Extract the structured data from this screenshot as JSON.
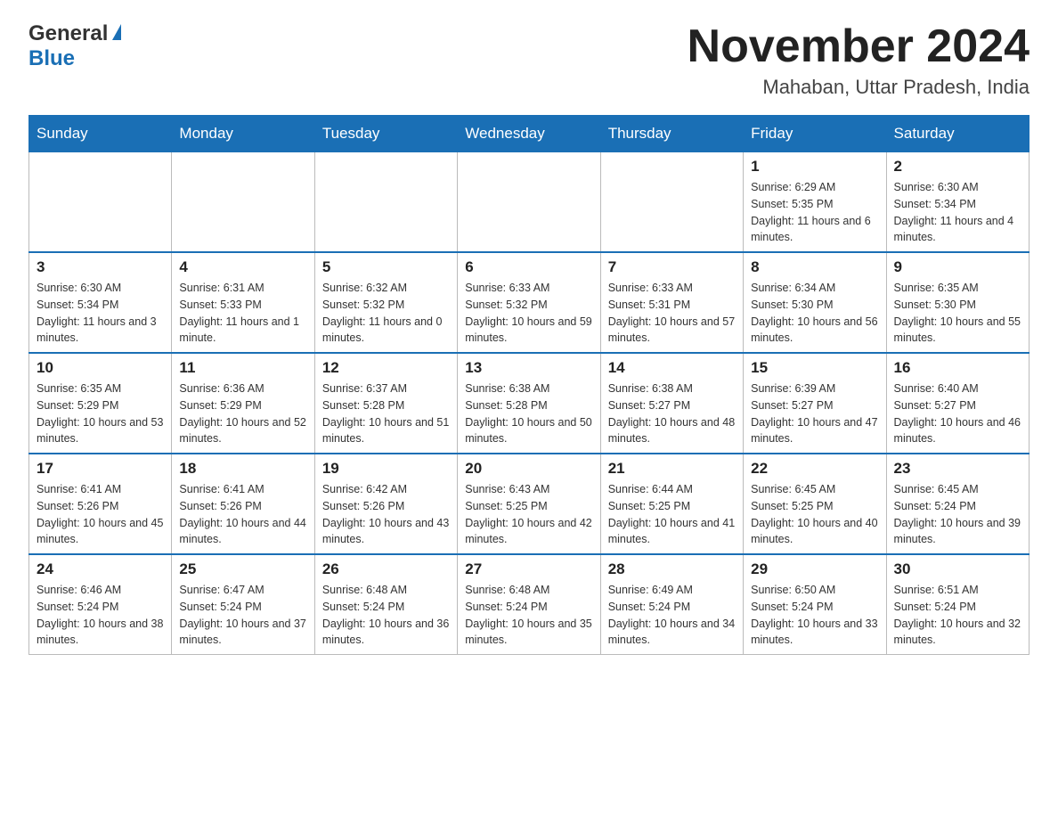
{
  "logo": {
    "general": "General",
    "blue": "Blue",
    "triangle": "▶"
  },
  "header": {
    "month_year": "November 2024",
    "location": "Mahaban, Uttar Pradesh, India"
  },
  "weekdays": [
    "Sunday",
    "Monday",
    "Tuesday",
    "Wednesday",
    "Thursday",
    "Friday",
    "Saturday"
  ],
  "rows": [
    {
      "cells": [
        {
          "day": "",
          "info": ""
        },
        {
          "day": "",
          "info": ""
        },
        {
          "day": "",
          "info": ""
        },
        {
          "day": "",
          "info": ""
        },
        {
          "day": "",
          "info": ""
        },
        {
          "day": "1",
          "info": "Sunrise: 6:29 AM\nSunset: 5:35 PM\nDaylight: 11 hours and 6 minutes."
        },
        {
          "day": "2",
          "info": "Sunrise: 6:30 AM\nSunset: 5:34 PM\nDaylight: 11 hours and 4 minutes."
        }
      ]
    },
    {
      "cells": [
        {
          "day": "3",
          "info": "Sunrise: 6:30 AM\nSunset: 5:34 PM\nDaylight: 11 hours and 3 minutes."
        },
        {
          "day": "4",
          "info": "Sunrise: 6:31 AM\nSunset: 5:33 PM\nDaylight: 11 hours and 1 minute."
        },
        {
          "day": "5",
          "info": "Sunrise: 6:32 AM\nSunset: 5:32 PM\nDaylight: 11 hours and 0 minutes."
        },
        {
          "day": "6",
          "info": "Sunrise: 6:33 AM\nSunset: 5:32 PM\nDaylight: 10 hours and 59 minutes."
        },
        {
          "day": "7",
          "info": "Sunrise: 6:33 AM\nSunset: 5:31 PM\nDaylight: 10 hours and 57 minutes."
        },
        {
          "day": "8",
          "info": "Sunrise: 6:34 AM\nSunset: 5:30 PM\nDaylight: 10 hours and 56 minutes."
        },
        {
          "day": "9",
          "info": "Sunrise: 6:35 AM\nSunset: 5:30 PM\nDaylight: 10 hours and 55 minutes."
        }
      ]
    },
    {
      "cells": [
        {
          "day": "10",
          "info": "Sunrise: 6:35 AM\nSunset: 5:29 PM\nDaylight: 10 hours and 53 minutes."
        },
        {
          "day": "11",
          "info": "Sunrise: 6:36 AM\nSunset: 5:29 PM\nDaylight: 10 hours and 52 minutes."
        },
        {
          "day": "12",
          "info": "Sunrise: 6:37 AM\nSunset: 5:28 PM\nDaylight: 10 hours and 51 minutes."
        },
        {
          "day": "13",
          "info": "Sunrise: 6:38 AM\nSunset: 5:28 PM\nDaylight: 10 hours and 50 minutes."
        },
        {
          "day": "14",
          "info": "Sunrise: 6:38 AM\nSunset: 5:27 PM\nDaylight: 10 hours and 48 minutes."
        },
        {
          "day": "15",
          "info": "Sunrise: 6:39 AM\nSunset: 5:27 PM\nDaylight: 10 hours and 47 minutes."
        },
        {
          "day": "16",
          "info": "Sunrise: 6:40 AM\nSunset: 5:27 PM\nDaylight: 10 hours and 46 minutes."
        }
      ]
    },
    {
      "cells": [
        {
          "day": "17",
          "info": "Sunrise: 6:41 AM\nSunset: 5:26 PM\nDaylight: 10 hours and 45 minutes."
        },
        {
          "day": "18",
          "info": "Sunrise: 6:41 AM\nSunset: 5:26 PM\nDaylight: 10 hours and 44 minutes."
        },
        {
          "day": "19",
          "info": "Sunrise: 6:42 AM\nSunset: 5:26 PM\nDaylight: 10 hours and 43 minutes."
        },
        {
          "day": "20",
          "info": "Sunrise: 6:43 AM\nSunset: 5:25 PM\nDaylight: 10 hours and 42 minutes."
        },
        {
          "day": "21",
          "info": "Sunrise: 6:44 AM\nSunset: 5:25 PM\nDaylight: 10 hours and 41 minutes."
        },
        {
          "day": "22",
          "info": "Sunrise: 6:45 AM\nSunset: 5:25 PM\nDaylight: 10 hours and 40 minutes."
        },
        {
          "day": "23",
          "info": "Sunrise: 6:45 AM\nSunset: 5:24 PM\nDaylight: 10 hours and 39 minutes."
        }
      ]
    },
    {
      "cells": [
        {
          "day": "24",
          "info": "Sunrise: 6:46 AM\nSunset: 5:24 PM\nDaylight: 10 hours and 38 minutes."
        },
        {
          "day": "25",
          "info": "Sunrise: 6:47 AM\nSunset: 5:24 PM\nDaylight: 10 hours and 37 minutes."
        },
        {
          "day": "26",
          "info": "Sunrise: 6:48 AM\nSunset: 5:24 PM\nDaylight: 10 hours and 36 minutes."
        },
        {
          "day": "27",
          "info": "Sunrise: 6:48 AM\nSunset: 5:24 PM\nDaylight: 10 hours and 35 minutes."
        },
        {
          "day": "28",
          "info": "Sunrise: 6:49 AM\nSunset: 5:24 PM\nDaylight: 10 hours and 34 minutes."
        },
        {
          "day": "29",
          "info": "Sunrise: 6:50 AM\nSunset: 5:24 PM\nDaylight: 10 hours and 33 minutes."
        },
        {
          "day": "30",
          "info": "Sunrise: 6:51 AM\nSunset: 5:24 PM\nDaylight: 10 hours and 32 minutes."
        }
      ]
    }
  ]
}
